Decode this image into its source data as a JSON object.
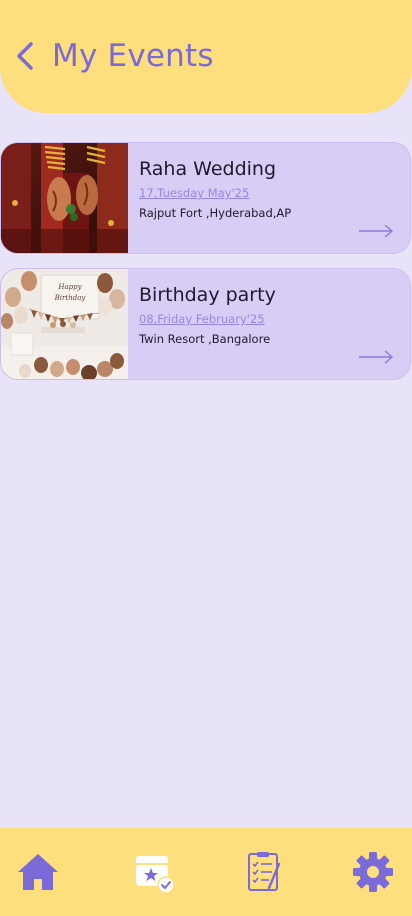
{
  "header": {
    "title": "My Events"
  },
  "events": [
    {
      "name": "Raha Wedding",
      "date": "17,Tuesday May'25",
      "location": "Rajput Fort ,Hyderabad,AP",
      "image": "wedding-hands-photo"
    },
    {
      "name": "Birthday party",
      "date": "08,Friday February'25",
      "location": "Twin Resort ,Bangalore",
      "image": "birthday-decoration-photo",
      "banner_text": "Happy Birthday"
    }
  ],
  "bottom_nav": {
    "items": [
      {
        "icon": "home-icon",
        "active": true
      },
      {
        "icon": "event-calendar-icon",
        "active": false
      },
      {
        "icon": "checklist-icon",
        "active": false
      },
      {
        "icon": "settings-icon",
        "active": false
      }
    ]
  },
  "colors": {
    "background": "#E9E3F9",
    "header": "#FDDF7E",
    "accent": "#7B6BD8",
    "card": "#D8CDF4",
    "date_link": "#9486E6"
  }
}
